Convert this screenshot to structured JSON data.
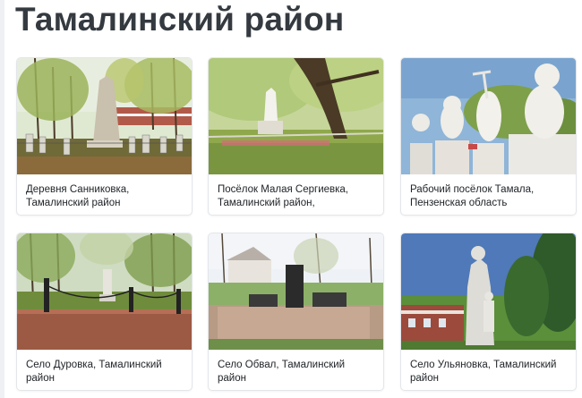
{
  "page": {
    "title": "Тамалинский район"
  },
  "cards": [
    {
      "caption": "Деревня Санниковка, Тамалинский район"
    },
    {
      "caption": "Посёлок Малая Сергиевка, Тамалинский район,"
    },
    {
      "caption": "Рабочий посёлок Тамала, Пензенская область"
    },
    {
      "caption": "Село Дуровка, Тамалинский район"
    },
    {
      "caption": "Село Обвал, Тамалинский район"
    },
    {
      "caption": "Село Ульяновка, Тамалинский район"
    }
  ]
}
